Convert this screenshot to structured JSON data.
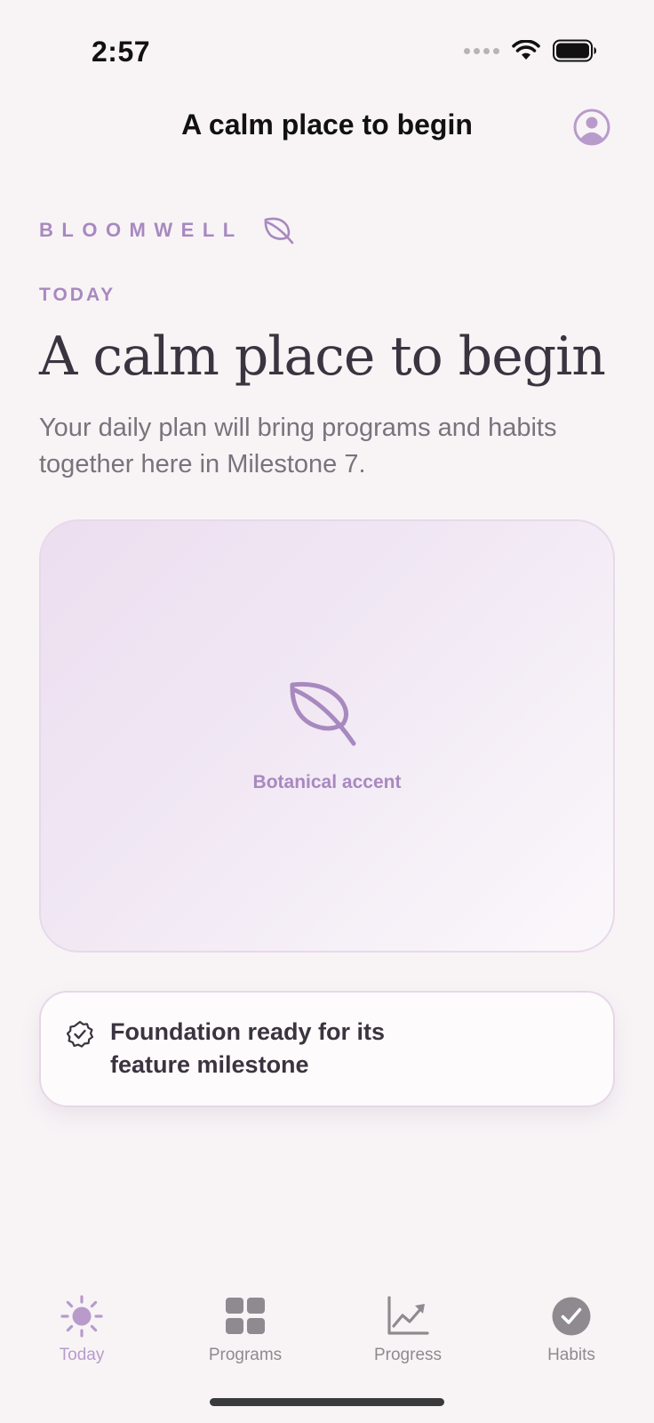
{
  "status_bar": {
    "time": "2:57"
  },
  "nav": {
    "title": "A calm place to begin",
    "profile_icon": "person-circle-icon"
  },
  "brand": {
    "name": "BLOOMWELL",
    "icon": "leaf-icon"
  },
  "main": {
    "eyebrow": "TODAY",
    "headline": "A calm place to begin",
    "subtext": "Your daily plan will bring programs and habits together here in Milestone 7.",
    "hero": {
      "icon": "leaf-icon",
      "caption": "Botanical accent"
    },
    "status_card": {
      "icon": "checkmark-seal-icon",
      "text": "Foundation ready for its feature milestone"
    }
  },
  "tabs": [
    {
      "label": "Today",
      "icon": "sun-icon",
      "active": true
    },
    {
      "label": "Programs",
      "icon": "grid-icon",
      "active": false
    },
    {
      "label": "Progress",
      "icon": "chart-icon",
      "active": false
    },
    {
      "label": "Habits",
      "icon": "checkmark-circle-icon",
      "active": false
    }
  ],
  "colors": {
    "background": "#f8f4f6",
    "accent": "#a889bf",
    "text_primary": "#3a3440",
    "text_secondary": "#79737b",
    "tab_inactive": "#8e8a8f"
  }
}
